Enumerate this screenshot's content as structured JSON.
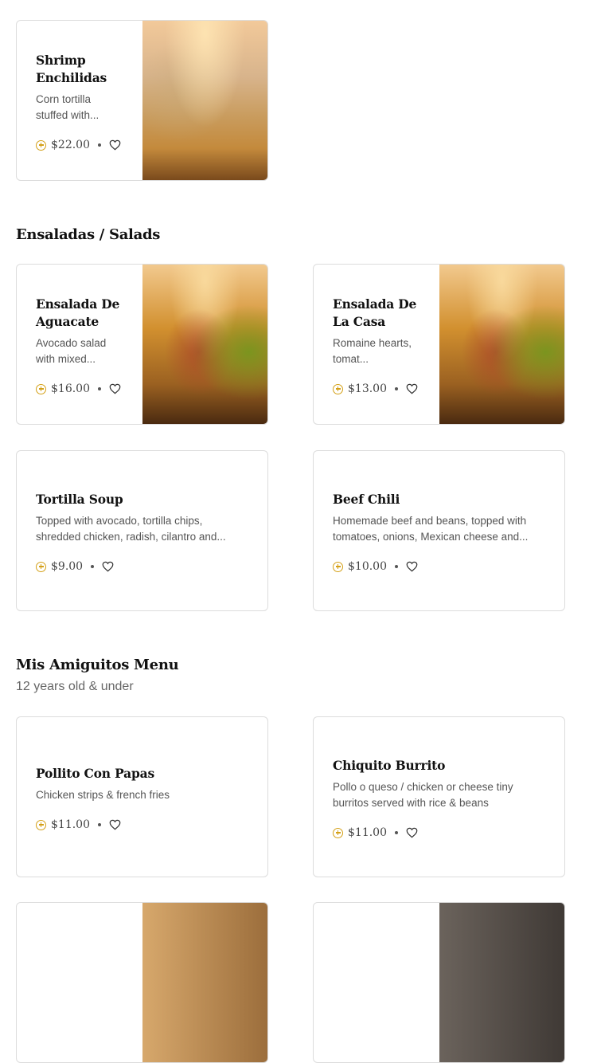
{
  "colors": {
    "accent": "#d4a017",
    "border": "#dcdcdc"
  },
  "icons": {
    "add": "plus-circle-icon",
    "favorite": "heart-icon"
  },
  "sections": [
    {
      "title": "Ensaladas / Salads"
    },
    {
      "title": "Mis Amiguitos Menu",
      "subtitle": "12 years old & under"
    }
  ],
  "items": [
    {
      "name": "Shrimp Enchilidas",
      "description": "Corn tortilla stuffed with...",
      "price": "$22.00"
    },
    {
      "name": "Ensalada De Aguacate",
      "description": "Avocado salad with mixed...",
      "price": "$16.00"
    },
    {
      "name": "Ensalada De La Casa",
      "description": "Romaine hearts, tomat...",
      "price": "$13.00"
    },
    {
      "name": "Tortilla Soup",
      "description": "Topped with avocado, tortilla chips, shredded chicken, radish, cilantro and...",
      "price": "$9.00"
    },
    {
      "name": "Beef Chili",
      "description": "Homemade beef and beans, topped with tomatoes, onions, Mexican cheese and...",
      "price": "$10.00"
    },
    {
      "name": "Pollito Con Papas",
      "description": "Chicken strips & french fries",
      "price": "$11.00"
    },
    {
      "name": "Chiquito Burrito",
      "description": "Pollo o queso / chicken or cheese tiny burritos served with rice & beans",
      "price": "$11.00"
    }
  ]
}
